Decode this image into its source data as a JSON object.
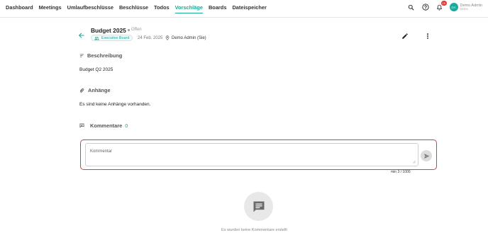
{
  "nav": {
    "items": [
      {
        "label": "Dashboard",
        "active": false
      },
      {
        "label": "Meetings",
        "active": false
      },
      {
        "label": "Umlaufbeschlüsse",
        "active": false
      },
      {
        "label": "Beschlüsse",
        "active": false
      },
      {
        "label": "Todos",
        "active": false
      },
      {
        "label": "Vorschläge",
        "active": true
      },
      {
        "label": "Boards",
        "active": false
      },
      {
        "label": "Dateispeicher",
        "active": false
      }
    ],
    "notification_count": "10",
    "user": {
      "initials": "DA",
      "name": "Demo Admin",
      "role": "Demo"
    }
  },
  "proposal": {
    "title": "Budget 2025",
    "status": "Offen",
    "board": "Executive Board",
    "date": "24 Feb. 2025",
    "author": "Demo Admin (Sie)"
  },
  "description": {
    "heading": "Beschreibung",
    "text": "Budget Q2 2025"
  },
  "attachments": {
    "heading": "Anhänge",
    "empty_text": "Es sind keine Anhänge vorhanden."
  },
  "comments": {
    "heading": "Kommentare",
    "count": "0",
    "placeholder": "Kommentar",
    "counter": "min  3 / 1000",
    "empty_text": "Es wurden keine Kommentare erstellt"
  },
  "colors": {
    "accent": "#1aa99a",
    "highlight_border": "#e53935"
  }
}
